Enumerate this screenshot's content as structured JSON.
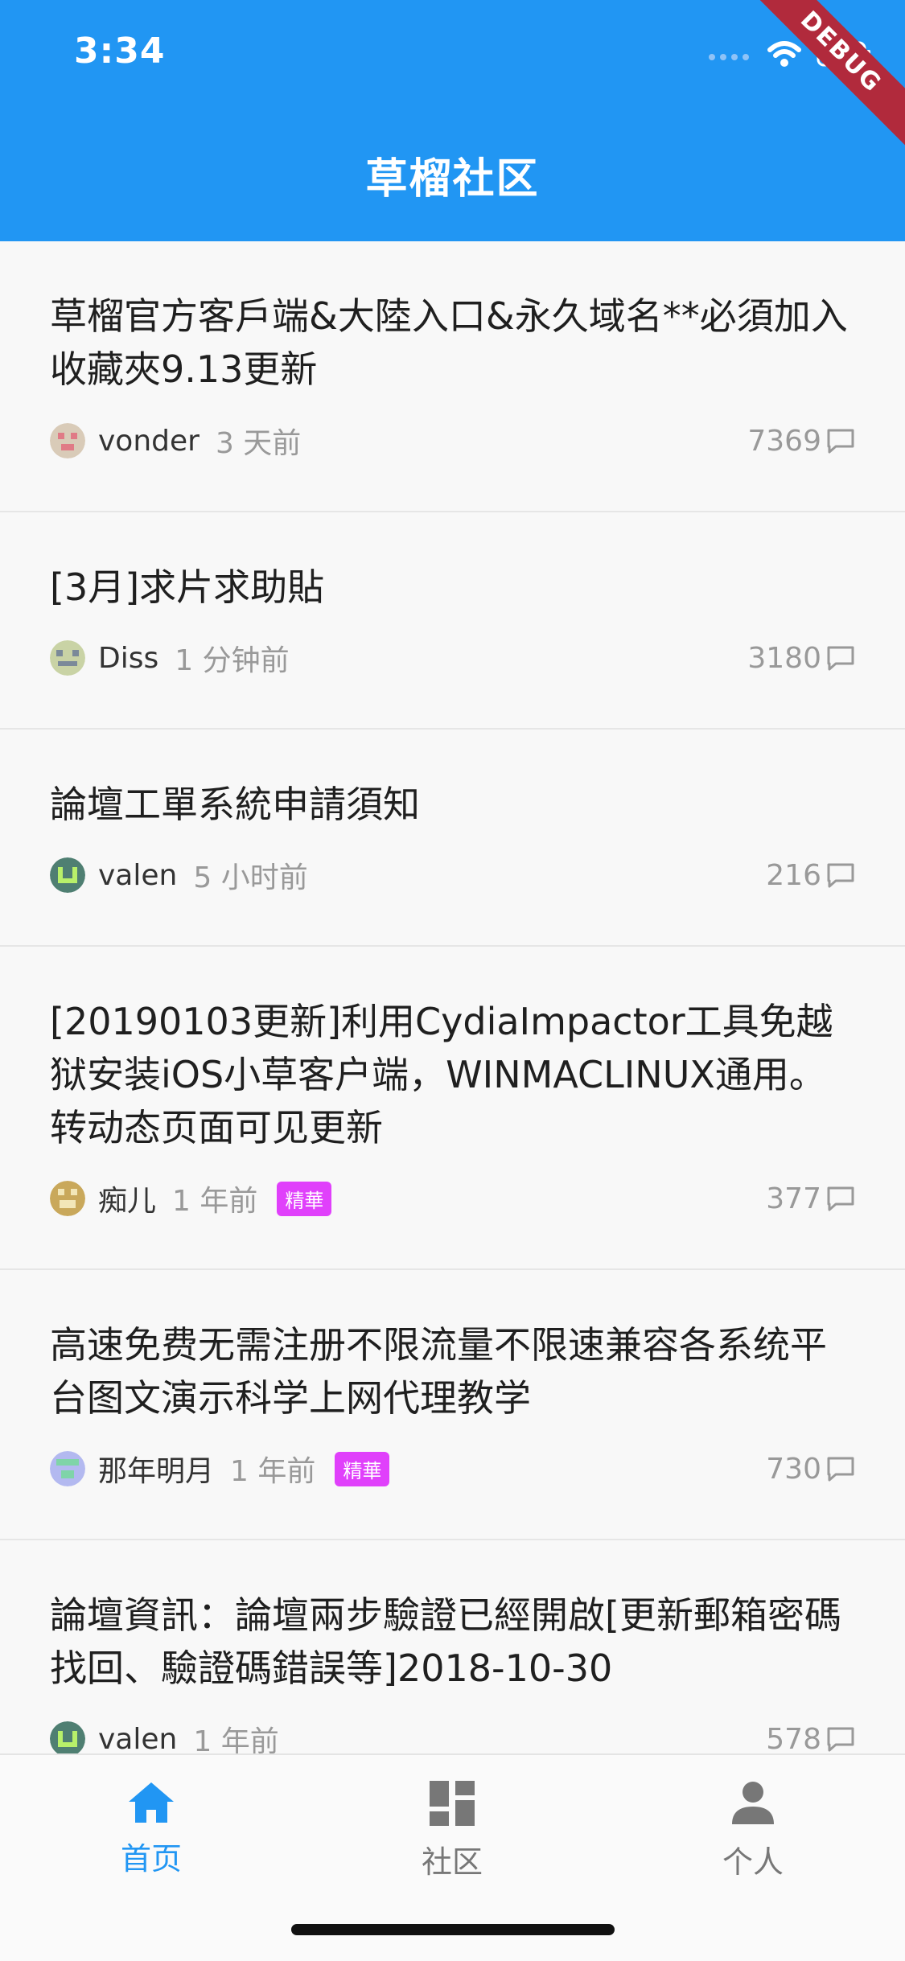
{
  "status_bar": {
    "time": "3:34"
  },
  "header": {
    "title": "草榴社区",
    "debug_label": "DEBUG"
  },
  "posts": [
    {
      "title": "草榴官方客戶端&大陸入口&永久域名**必須加入收藏夾9.13更新",
      "author": "vonder",
      "time": "3 天前",
      "replies": "7369",
      "badge": ""
    },
    {
      "title": "[3月]求片求助貼",
      "author": "Diss",
      "time": "1 分钟前",
      "replies": "3180",
      "badge": ""
    },
    {
      "title": "論壇工單系統申請須知",
      "author": "valen",
      "time": "5 小时前",
      "replies": "216",
      "badge": ""
    },
    {
      "title": "[20190103更新]利用CydiaImpactor工具免越狱安装iOS小草客户端，WINMACLINUX通用。转动态页面可见更新",
      "author": "痴儿",
      "time": "1 年前",
      "replies": "377",
      "badge": "精華"
    },
    {
      "title": "高速免费无需注册不限流量不限速兼容各系统平台图文演示科学上网代理教学",
      "author": "那年明月",
      "time": "1 年前",
      "replies": "730",
      "badge": "精華"
    },
    {
      "title": "論壇資訊：論壇兩步驗證已經開啟[更新郵箱密碼找回、驗證碼錯誤等]2018-10-30",
      "author": "valen",
      "time": "1 年前",
      "replies": "578",
      "badge": ""
    }
  ],
  "bottom_nav": {
    "items": [
      {
        "label": "首页",
        "icon": "home-icon",
        "active": true
      },
      {
        "label": "社区",
        "icon": "dashboard-icon",
        "active": false
      },
      {
        "label": "个人",
        "icon": "person-icon",
        "active": false
      }
    ]
  },
  "colors": {
    "primary": "#2196f3",
    "badge": "#e040fb"
  }
}
